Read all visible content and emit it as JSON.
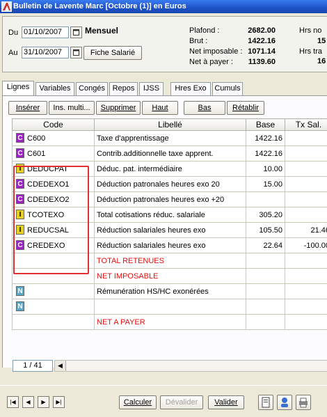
{
  "window": {
    "title": "Bulletin de Lavente Marc  [Octobre (1)] en Euros"
  },
  "header": {
    "du_label": "Du",
    "du_value": "01/10/2007",
    "au_label": "Au",
    "au_value": "31/10/2007",
    "periodicity": "Mensuel",
    "fiche_button": "Fiche Salarié",
    "plafond_label": "Plafond :",
    "plafond_value": "2682.00",
    "brut_label": "Brut :",
    "brut_value": "1422.16",
    "net_imposable_label": "Net imposable :",
    "net_imposable_value": "1071.14",
    "net_payer_label": "Net à payer :",
    "net_payer_value": "1139.60",
    "hrs1_label": "Hrs no",
    "hrs1_value": "15",
    "hrs2_label": "Hrs tra",
    "hrs2_value": "16"
  },
  "tabs": [
    "Lignes",
    "Variables",
    "Congés",
    "Repos",
    "IJSS",
    "Hres Exo",
    "Cumuls"
  ],
  "toolbar": [
    "Insérer",
    "Ins. multi...",
    "Supprimer",
    "Haut",
    "Bas",
    "Rétablir"
  ],
  "grid": {
    "columns": [
      "Code",
      "Libellé",
      "Base",
      "Tx Sal."
    ],
    "rows": [
      {
        "type": "C",
        "code": "C600",
        "libelle": "Taxe d'apprentissage",
        "base": "1422.16",
        "tx": ""
      },
      {
        "type": "C",
        "code": "C601",
        "libelle": "Contrib.additionnelle taxe apprent.",
        "base": "1422.16",
        "tx": ""
      },
      {
        "type": "I",
        "code": "DEDUCPAT",
        "libelle": "Déduc. pat. intermédiaire",
        "base": "10.00",
        "tx": ""
      },
      {
        "type": "C",
        "code": "CDEDEXO1",
        "libelle": "Déduction patronales heures exo 20",
        "base": "15.00",
        "tx": ""
      },
      {
        "type": "C",
        "code": "CDEDEXO2",
        "libelle": "Déduction patronales heures exo +20",
        "base": "",
        "tx": ""
      },
      {
        "type": "I",
        "code": "TCOTEXO",
        "libelle": "Total cotisations réduc. salariale",
        "base": "305.20",
        "tx": ""
      },
      {
        "type": "I",
        "code": "REDUCSAL",
        "libelle": "Réduction salariales heures exo",
        "base": "105.50",
        "tx": "21.46"
      },
      {
        "type": "C",
        "code": "CREDEXO",
        "libelle": "Réduction salariales heures exo",
        "base": "22.64",
        "tx": "-100.00"
      },
      {
        "type": "",
        "code": "",
        "libelle": "TOTAL RETENUES",
        "base": "",
        "tx": "",
        "red": true
      },
      {
        "type": "",
        "code": "",
        "libelle": "NET IMPOSABLE",
        "base": "",
        "tx": "",
        "red": true
      },
      {
        "type": "N",
        "code": "",
        "libelle": "Rémunération HS/HC exonérées",
        "base": "",
        "tx": ""
      },
      {
        "type": "N",
        "code": "",
        "libelle": "",
        "base": "",
        "tx": ""
      },
      {
        "type": "",
        "code": "",
        "libelle": "NET A PAYER",
        "base": "",
        "tx": "",
        "red": true
      }
    ]
  },
  "pager": {
    "position": "1 / 41"
  },
  "bottom": {
    "calculer": "Calculer",
    "devalider": "Dévalider",
    "valider": "Valider"
  }
}
